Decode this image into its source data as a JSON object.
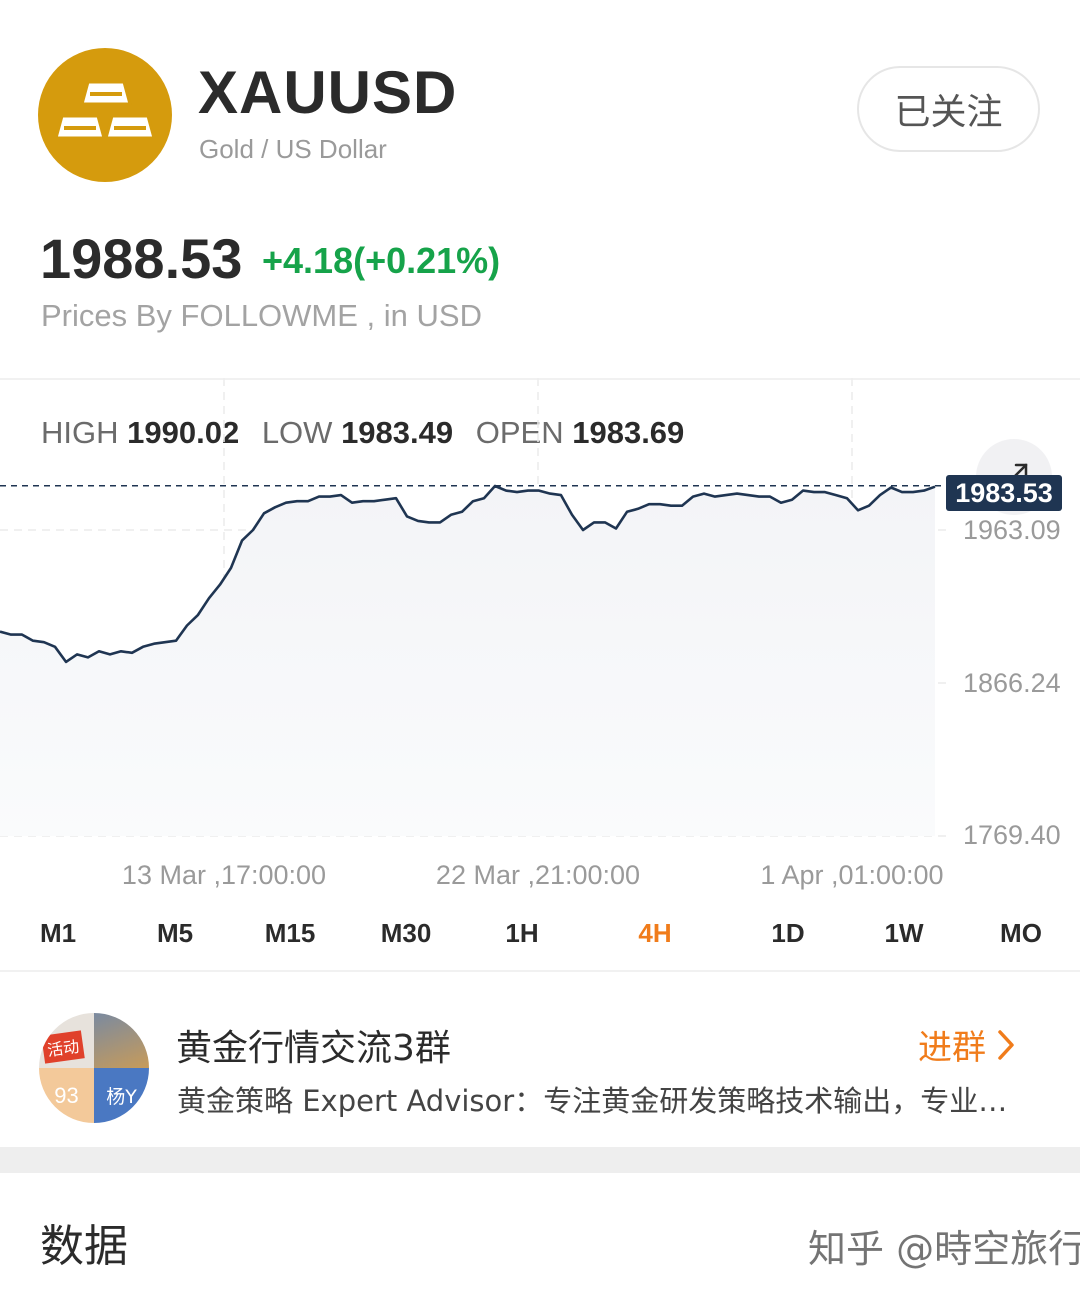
{
  "header": {
    "symbol": "XAUUSD",
    "pair_name": "Gold / US Dollar",
    "follow_label": "已关注",
    "logo_icon": "gold-bars-icon",
    "logo_color": "#d59b0d"
  },
  "quote": {
    "price": "1988.53",
    "change": "+4.18(+0.21%)",
    "change_color": "#16a34a",
    "source": "Prices By FOLLOWME , in USD"
  },
  "ohlc": {
    "high_label": "HIGH",
    "high": "1990.02",
    "low_label": "LOW",
    "low": "1983.49",
    "open_label": "OPEN",
    "open": "1983.69"
  },
  "chart_data": {
    "type": "line",
    "series": [
      {
        "values": [
          1893,
          1891,
          1891,
          1887,
          1886,
          1883,
          1873,
          1878,
          1876,
          1880,
          1878,
          1880,
          1879,
          1883,
          1885,
          1886,
          1887,
          1897,
          1904,
          1915,
          1924,
          1935,
          1953,
          1960,
          1971,
          1975,
          1978,
          1979,
          1979,
          1982,
          1982,
          1983,
          1978,
          1979,
          1979,
          1980,
          1981,
          1969,
          1966,
          1965,
          1965,
          1970,
          1972,
          1979,
          1981,
          1989,
          1986,
          1985,
          1986,
          1986,
          1984,
          1983,
          1970,
          1960,
          1965,
          1965,
          1961,
          1972,
          1974,
          1977,
          1977,
          1976,
          1976,
          1982,
          1984,
          1982,
          1983,
          1984,
          1983,
          1982,
          1982,
          1978,
          1980,
          1986,
          1985,
          1985,
          1983,
          1981,
          1973,
          1976,
          1983,
          1988,
          1985,
          1985,
          1986,
          1988.53
        ],
        "line_color": "#1f3552"
      }
    ],
    "x_tick_labels": [
      "13 Mar ,17:00:00",
      "22 Mar ,21:00:00",
      "1 Apr ,01:00:00"
    ],
    "y_tick_labels": [
      "1963.09",
      "1866.24",
      "1769.40"
    ],
    "current_value_label": "1983.53",
    "grid": true,
    "current_value_line": "dashed"
  },
  "intervals": {
    "items": [
      {
        "label": "M1"
      },
      {
        "label": "M5"
      },
      {
        "label": "M15"
      },
      {
        "label": "M30"
      },
      {
        "label": "1H"
      },
      {
        "label": "4H"
      },
      {
        "label": "1D"
      },
      {
        "label": "1W"
      },
      {
        "label": "MO"
      }
    ],
    "active": "4H",
    "active_color": "#f07c1b"
  },
  "group": {
    "name": "黄金行情交流3群",
    "description": "黄金策略 Expert Advisor：专注黄金研发策略技术输出，专业…",
    "join_label": "进群",
    "avatar_tag": "活动",
    "avatar_num": "93",
    "avatar_name": "杨Y"
  },
  "data_section": {
    "title": "数据"
  },
  "watermark": "知乎 @時空旅行者"
}
